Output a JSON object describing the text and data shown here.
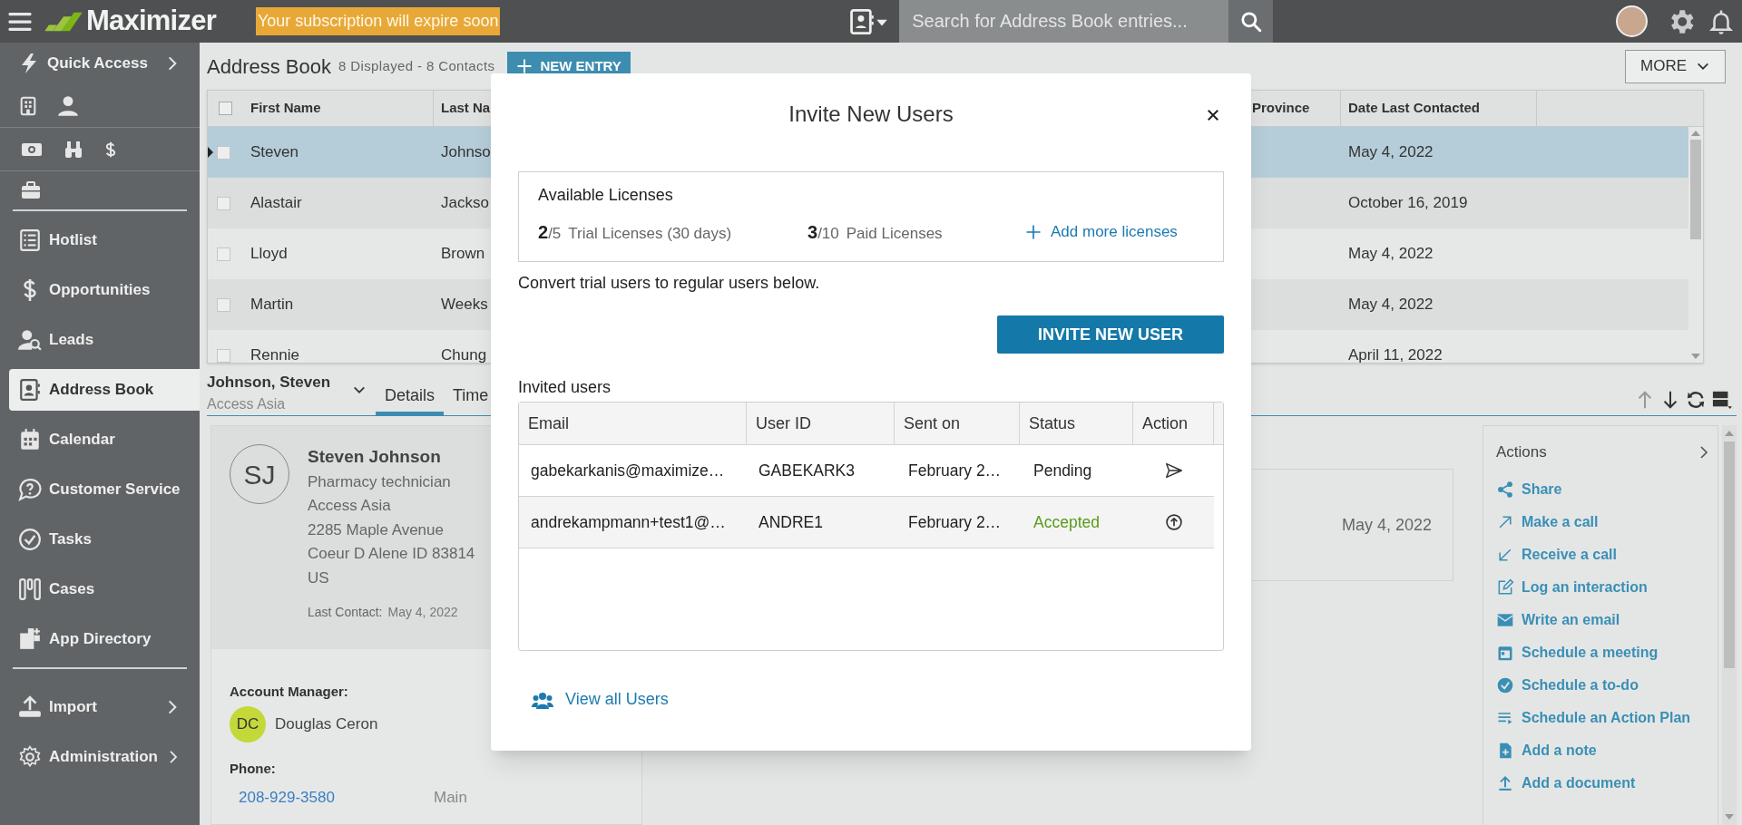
{
  "topbar": {
    "logo": "Maximizer",
    "notice": "Your subscription will expire soon",
    "search": {
      "placeholder": "Search for Address Book entries..."
    }
  },
  "sidebar": {
    "quick_access": {
      "label": "Quick Access"
    },
    "items": [
      {
        "label": "Hotlist",
        "selected": false,
        "expandable": false
      },
      {
        "label": "Opportunities",
        "selected": false,
        "expandable": false
      },
      {
        "label": "Leads",
        "selected": false,
        "expandable": false
      },
      {
        "label": "Address Book",
        "selected": true,
        "expandable": false
      },
      {
        "label": "Calendar",
        "selected": false,
        "expandable": false
      },
      {
        "label": "Customer Service",
        "selected": false,
        "expandable": false
      },
      {
        "label": "Tasks",
        "selected": false,
        "expandable": false
      },
      {
        "label": "Cases",
        "selected": false,
        "expandable": false
      },
      {
        "label": "App Directory",
        "selected": false,
        "expandable": false
      },
      {
        "label": "Import",
        "selected": false,
        "expandable": true
      },
      {
        "label": "Administration",
        "selected": false,
        "expandable": true
      }
    ]
  },
  "header": {
    "title": "Address Book",
    "count": "8 Displayed - 8 Contacts",
    "new_button": "NEW ENTRY",
    "more_button": "MORE"
  },
  "grid": {
    "all_checked": false,
    "columns": [
      "First Name",
      "Last Na",
      "Province",
      "Date Last Contacted"
    ],
    "rows": [
      {
        "first": "Steven",
        "last": "Johnso",
        "date": "May 4, 2022",
        "selected": true,
        "checked": false
      },
      {
        "first": "Alastair",
        "last": "Jackso",
        "date": "October 16, 2019",
        "selected": false,
        "checked": false
      },
      {
        "first": "Lloyd",
        "last": "Brown",
        "date": "May 4, 2022",
        "selected": false,
        "checked": false
      },
      {
        "first": "Martin",
        "last": "Weeks",
        "date": "May 4, 2022",
        "selected": false,
        "checked": false
      },
      {
        "first": "Rennie",
        "last": "Chung",
        "date": "April 11, 2022",
        "selected": false,
        "checked": false
      }
    ]
  },
  "detail": {
    "name": "Johnson, Steven",
    "company": "Access Asia",
    "tabs": [
      {
        "label": "Details",
        "selected": true
      },
      {
        "label": "Time",
        "selected": false
      }
    ],
    "card": {
      "initials": "SJ",
      "full_name": "Steven Johnson",
      "lines": [
        "Pharmacy technician",
        "Access Asia",
        "2285 Maple Avenue",
        "Coeur D Alene ID 83814",
        "US"
      ],
      "last_contact_label": "Last Contact:",
      "last_contact": "May 4, 2022"
    },
    "account_manager": {
      "label": "Account Manager:",
      "initials": "DC",
      "name": "Douglas Ceron"
    },
    "phone": {
      "label": "Phone:",
      "number": "208-929-3580",
      "type": "Main"
    },
    "middle_date": "May 4, 2022",
    "actions": {
      "title": "Actions",
      "items": [
        "Share",
        "Make a call",
        "Receive a call",
        "Log an interaction",
        "Write an email",
        "Schedule a meeting",
        "Schedule a to-do",
        "Schedule an Action Plan",
        "Add a note",
        "Add a document"
      ]
    }
  },
  "modal": {
    "title": "Invite New Users",
    "licenses": {
      "title": "Available Licenses",
      "trial": {
        "used": "2",
        "total": "/5",
        "label": "Trial Licenses (30 days)"
      },
      "paid": {
        "used": "3",
        "total": "/10",
        "label": "Paid Licenses"
      },
      "add_link": "Add more licenses"
    },
    "note": "Convert trial users to regular users below.",
    "invite_button": "INVITE NEW USER",
    "table_title": "Invited users",
    "columns": [
      "Email",
      "User ID",
      "Sent on",
      "Status",
      "Action"
    ],
    "rows": [
      {
        "email": "gabekarkanis@maximize…",
        "user_id": "GABEKARK3",
        "sent_on": "February 2…",
        "status": "Pending",
        "kind": "pending"
      },
      {
        "email": "andrekampmann+test1@…",
        "user_id": "ANDRE1",
        "sent_on": "February 2…",
        "status": "Accepted",
        "kind": "accepted"
      }
    ],
    "view_all": "View all Users"
  }
}
